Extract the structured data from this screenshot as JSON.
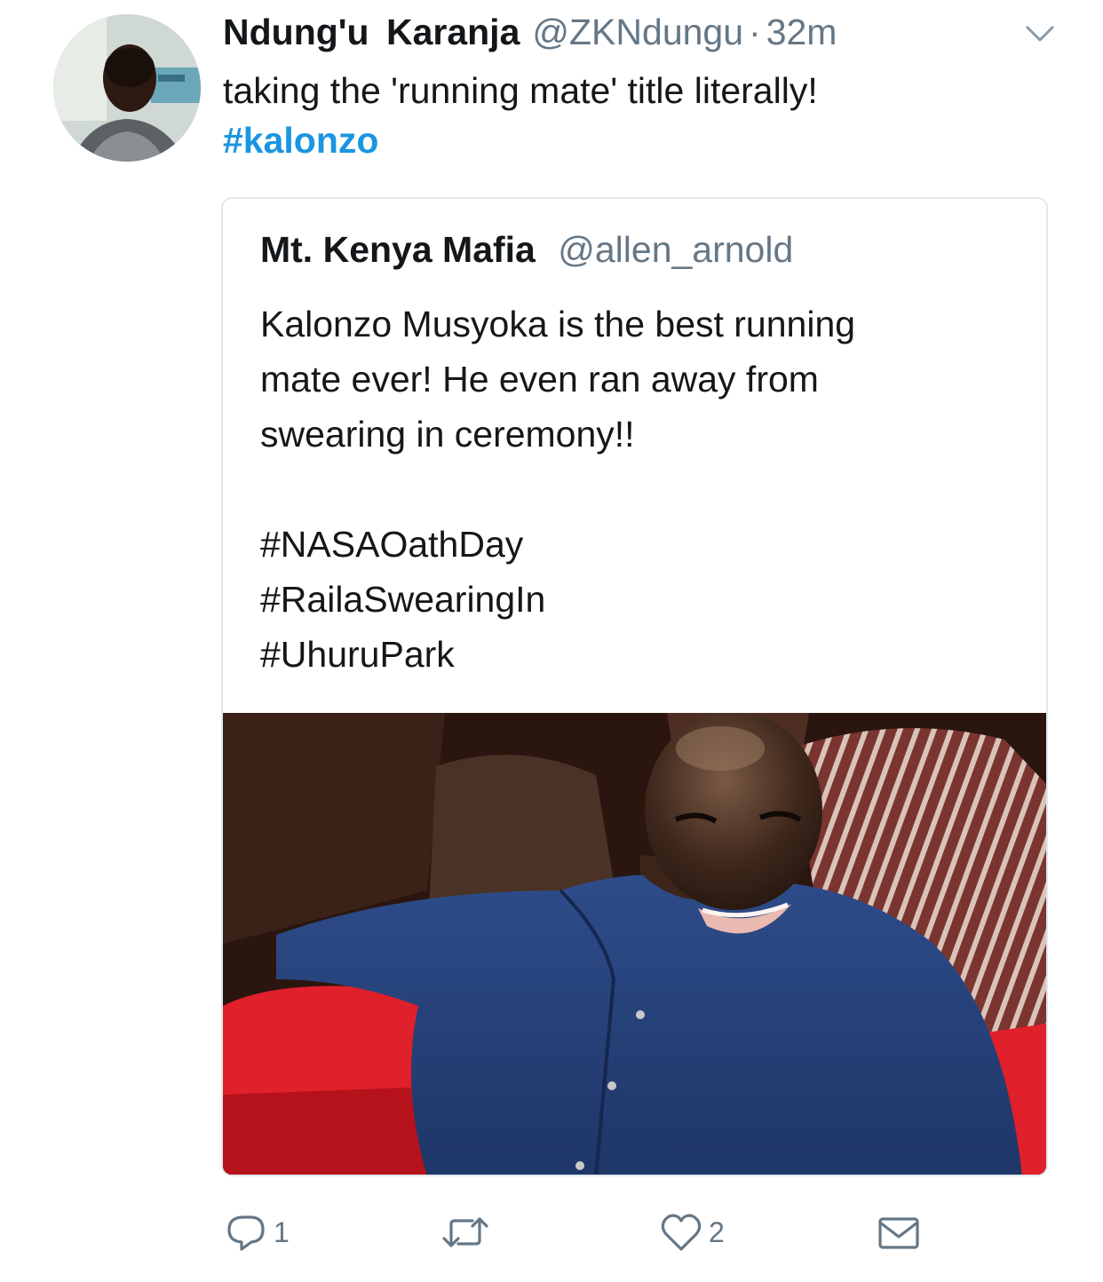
{
  "tweet": {
    "display_name": "Ndung'u Karanja",
    "handle": "@ZKNdungu",
    "separator": "·",
    "time": "32m",
    "text": "taking the 'running mate' title literally!",
    "hashtag": "#kalonzo"
  },
  "quoted_tweet": {
    "display_name": "Mt. Kenya Mafia",
    "handle": "@allen_arnold",
    "lines": [
      "Kalonzo Musyoka is the best running",
      "mate ever! He even ran away from",
      "swearing in ceremony!!"
    ],
    "hashtags": [
      "#NASAOathDay",
      "#RailaSwearingIn",
      "#UhuruPark"
    ]
  },
  "actions": {
    "reply_count": "1",
    "retweet_count": "",
    "like_count": "2"
  },
  "icons": {
    "reply": "reply-icon",
    "retweet": "retweet-icon",
    "like": "heart-icon",
    "dm": "envelope-icon",
    "menu": "chevron-down-icon"
  },
  "colors": {
    "link": "#1b95e0",
    "secondary_text": "#657786",
    "primary_text": "#14171a",
    "card_border": "#e1e8ed"
  }
}
